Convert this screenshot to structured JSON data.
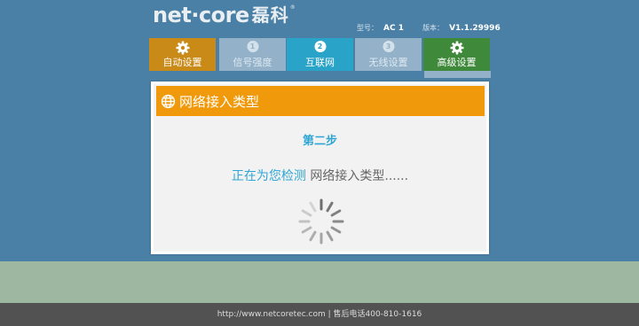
{
  "brand": {
    "logo_text": "net·core",
    "logo_cn": "磊科",
    "registered": "®"
  },
  "device": {
    "model_label": "型号：",
    "model_value": "AC 1",
    "version_label": "版本：",
    "version_value": "V1.1.29996"
  },
  "nav": {
    "auto_label": "自动设置",
    "signal_label": "信号强度",
    "signal_step": "1",
    "internet_label": "互联网",
    "internet_step": "2",
    "wireless_label": "无线设置",
    "wireless_step": "3",
    "advanced_label": "高级设置"
  },
  "dialog": {
    "title": "网络接入类型",
    "step_title": "第二步",
    "detecting_prefix": "正在为您检测",
    "detecting_suffix": " 网络接入类型......"
  },
  "footer": {
    "text": "http://www.netcoretec.com | 售后电话400-810-1616"
  },
  "icons": {
    "globe": "globe-icon",
    "gear": "gear-icon",
    "spinner": "loading-spinner-icon"
  },
  "colors": {
    "accent_orange": "#f09a0b",
    "accent_blue": "#30a6d4",
    "header_bg": "#4a80a5",
    "footer_bg": "#525252"
  }
}
